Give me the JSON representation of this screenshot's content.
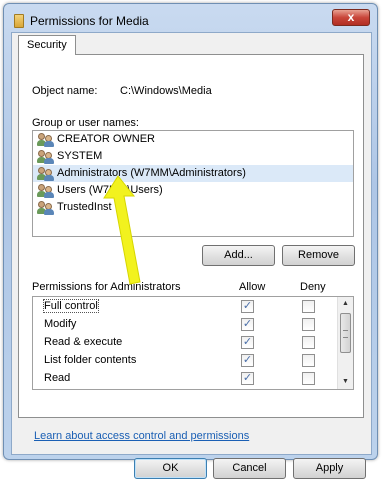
{
  "window": {
    "title": "Permissions for Media",
    "close_label": "x"
  },
  "tabs": [
    {
      "label": "Security"
    }
  ],
  "object": {
    "label": "Object name:",
    "value": "C:\\Windows\\Media"
  },
  "groups": {
    "label": "Group or user names:",
    "items": [
      {
        "label": "CREATOR OWNER"
      },
      {
        "label": "SYSTEM"
      },
      {
        "label": "Administrators (W7MM\\Administrators)"
      },
      {
        "label": "Users (W7MM\\Users)"
      },
      {
        "label": "TrustedInst"
      }
    ],
    "add_label": "Add...",
    "remove_label": "Remove"
  },
  "permissions": {
    "label": "Permissions for Administrators",
    "allow_header": "Allow",
    "deny_header": "Deny",
    "rows": [
      {
        "label": "Full control",
        "allow": true,
        "deny": false
      },
      {
        "label": "Modify",
        "allow": true,
        "deny": false
      },
      {
        "label": "Read & execute",
        "allow": true,
        "deny": false
      },
      {
        "label": "List folder contents",
        "allow": true,
        "deny": false
      },
      {
        "label": "Read",
        "allow": true,
        "deny": false
      }
    ]
  },
  "learn_link": "Learn about access control and permissions",
  "buttons": {
    "ok": "OK",
    "cancel": "Cancel",
    "apply": "Apply"
  },
  "colors": {
    "arrow": "#f2f21e",
    "link": "#1a5fb4",
    "selection": "#dbe9f8"
  },
  "icons": {
    "title": "folder-icon",
    "user": "user-group-icon",
    "checkbox": "check-icon"
  }
}
